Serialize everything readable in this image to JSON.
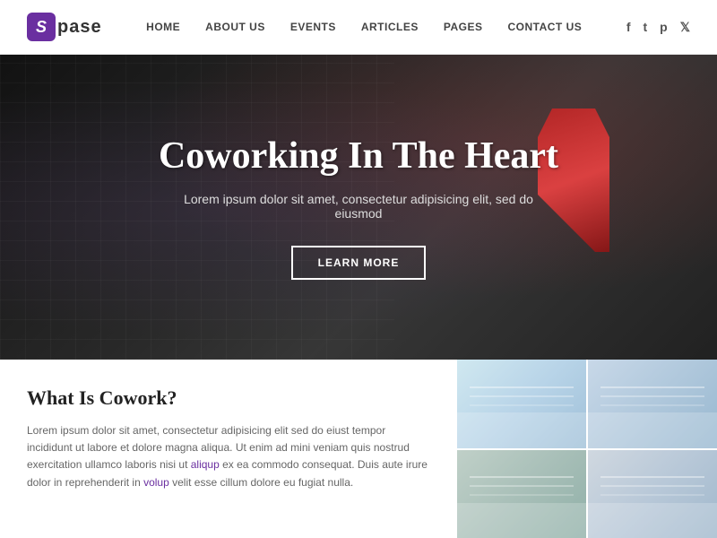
{
  "header": {
    "logo_letter": "S",
    "logo_name": "pase",
    "nav": [
      {
        "label": "HOME",
        "href": "#"
      },
      {
        "label": "ABOUT US",
        "href": "#"
      },
      {
        "label": "EVENTS",
        "href": "#"
      },
      {
        "label": "ARTICLES",
        "href": "#"
      },
      {
        "label": "PAGES",
        "href": "#"
      },
      {
        "label": "CONTACT US",
        "href": "#"
      }
    ],
    "social": [
      {
        "label": "f",
        "name": "facebook"
      },
      {
        "label": "t",
        "name": "tumblr"
      },
      {
        "label": "p",
        "name": "pinterest"
      },
      {
        "label": "𝕏",
        "name": "twitter"
      }
    ]
  },
  "hero": {
    "title": "Coworking In The Heart",
    "subtitle": "Lorem ipsum dolor sit amet, consectetur adipisicing elit, sed do eiusmod",
    "button_label": "LEARN MORE"
  },
  "content": {
    "title": "What Is Cowork?",
    "text_part1": "Lorem ipsum dolor sit amet, consectetur adipisicing elit sed do eiust tempor incididunt ut labore et dolore magna aliqua. Ut enim ad mini veniam quis nostrud exercitation ullamco laboris nisi ut ",
    "text_link1": "aliqup",
    "text_part2": " ex ea commodo consequat. Duis aute irure dolor in reprehenderit in ",
    "text_link2": "volup",
    "text_part3": " velit esse cillum dolore eu fugiat nulla."
  }
}
